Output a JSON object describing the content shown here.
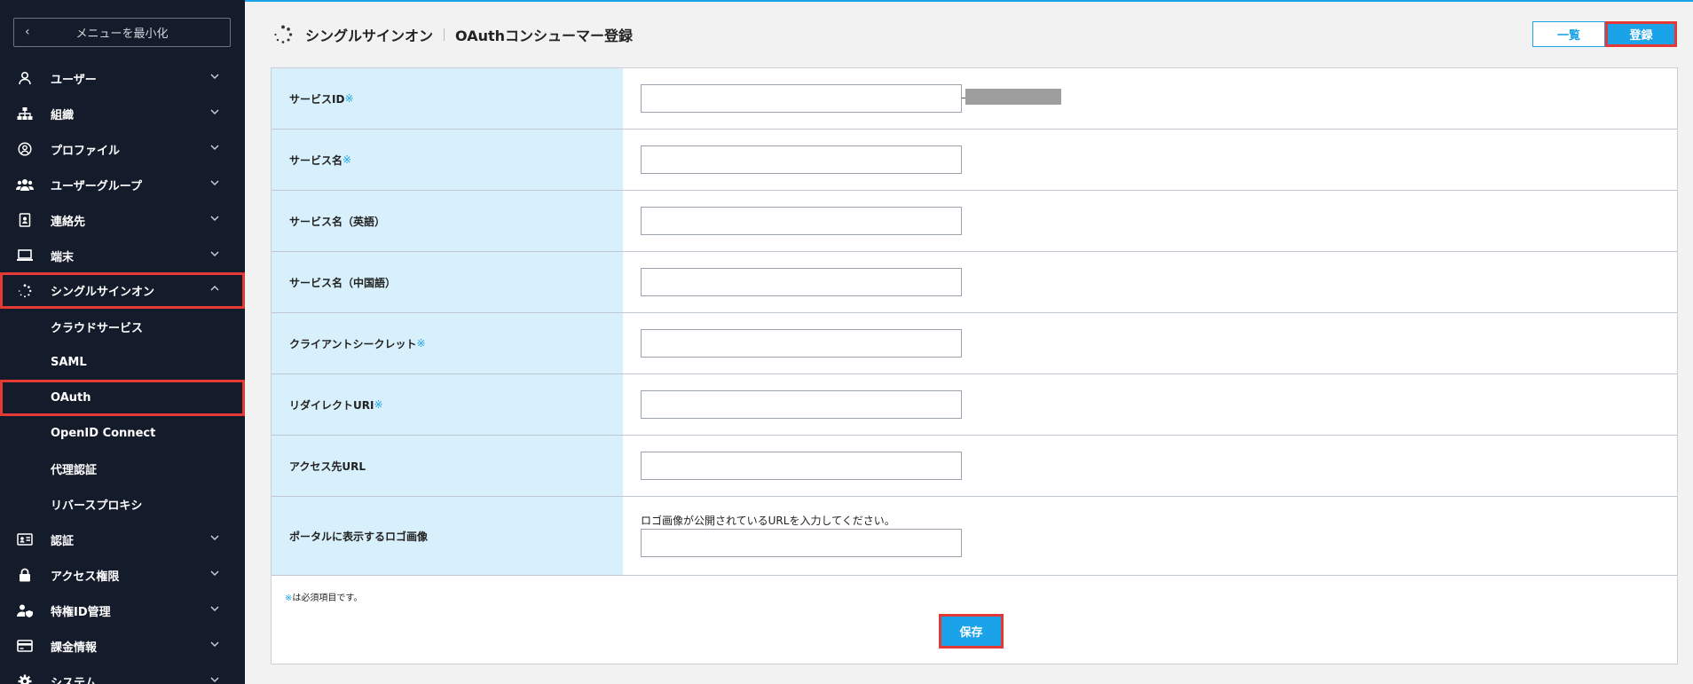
{
  "sidebar": {
    "minimize_label": "メニューを最小化",
    "items": [
      {
        "label": "ユーザー",
        "icon": "user-icon"
      },
      {
        "label": "組織",
        "icon": "org-chart-icon"
      },
      {
        "label": "プロファイル",
        "icon": "profile-icon"
      },
      {
        "label": "ユーザーグループ",
        "icon": "user-group-icon"
      },
      {
        "label": "連絡先",
        "icon": "contact-book-icon"
      },
      {
        "label": "端末",
        "icon": "laptop-icon"
      },
      {
        "label": "シングルサインオン",
        "icon": "sso-spinner-icon"
      },
      {
        "label": "認証",
        "icon": "id-card-icon"
      },
      {
        "label": "アクセス権限",
        "icon": "lock-icon"
      },
      {
        "label": "特権ID管理",
        "icon": "user-shield-icon"
      },
      {
        "label": "課金情報",
        "icon": "credit-card-icon"
      },
      {
        "label": "システム",
        "icon": "gear-icon"
      }
    ],
    "sso_sub_items": [
      "クラウドサービス",
      "SAML",
      "OAuth",
      "OpenID Connect",
      "代理認証",
      "リバースプロキシ"
    ]
  },
  "header": {
    "section": "シングルサインオン",
    "page": "OAuthコンシューマー登録",
    "list_button": "一覧",
    "register_button": "登録"
  },
  "form": {
    "required_mark": "※",
    "fields": [
      {
        "label": "サービスID",
        "required": true
      },
      {
        "label": "サービス名",
        "required": true
      },
      {
        "label": "サービス名（英語）",
        "required": false
      },
      {
        "label": "サービス名（中国語）",
        "required": false
      },
      {
        "label": "クライアントシークレット",
        "required": true
      },
      {
        "label": "リダイレクトURI",
        "required": true
      },
      {
        "label": "アクセス先URL",
        "required": false
      },
      {
        "label": "ポータルに表示するロゴ画像",
        "required": false,
        "hint": "ロゴ画像が公開されているURLを入力してください。"
      }
    ],
    "note_text": "は必須項目です。",
    "save_button": "保存"
  }
}
